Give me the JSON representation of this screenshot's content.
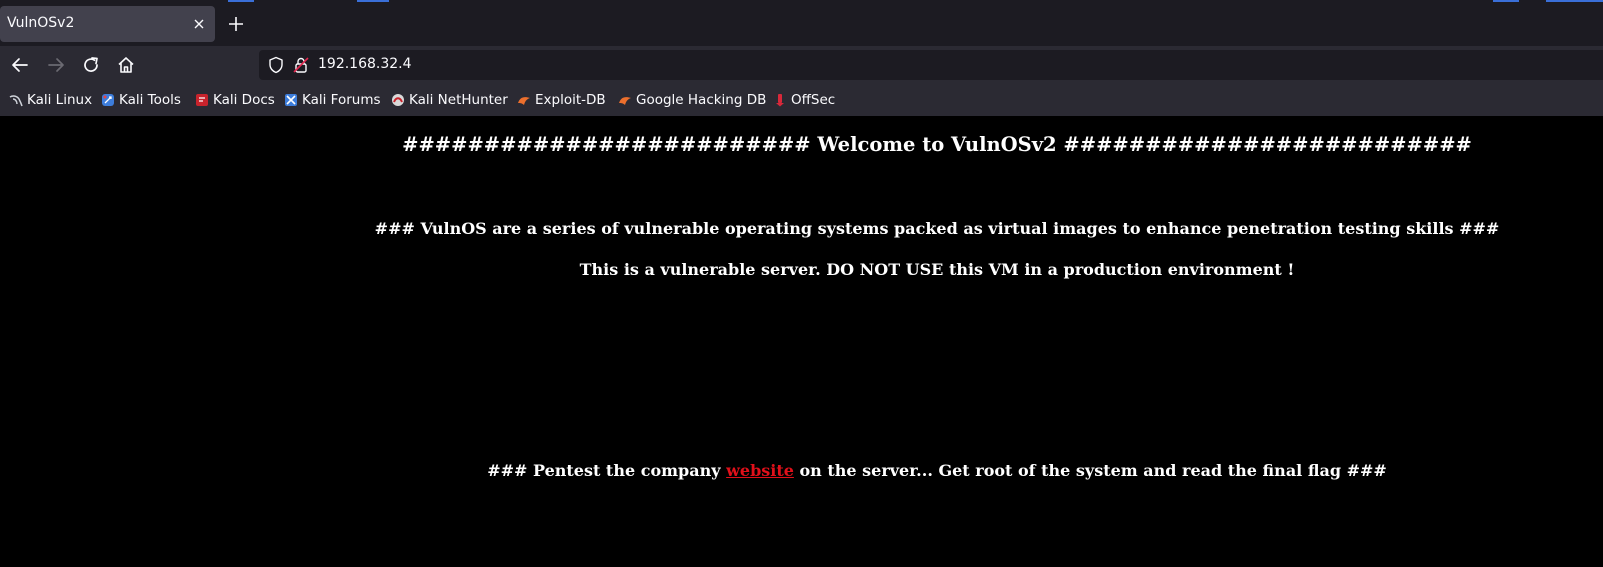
{
  "browser": {
    "tab_title": "VulnOSv2",
    "url": "192.168.32.4",
    "bookmarks": [
      {
        "label": "Kali Linux",
        "icon": "kali-dragon-icon"
      },
      {
        "label": "Kali Tools",
        "icon": "kali-tools-icon"
      },
      {
        "label": "Kali Docs",
        "icon": "kali-docs-icon"
      },
      {
        "label": "Kali Forums",
        "icon": "kali-forums-icon"
      },
      {
        "label": "Kali NetHunter",
        "icon": "kali-nethunter-icon"
      },
      {
        "label": "Exploit-DB",
        "icon": "exploit-db-icon"
      },
      {
        "label": "Google Hacking DB",
        "icon": "ghdb-icon"
      },
      {
        "label": "OffSec",
        "icon": "offsec-icon"
      }
    ]
  },
  "page": {
    "heading": "######################### Welcome to VulnOSv2 #########################",
    "intro": "### VulnOS are a series of vulnerable operating systems packed as virtual images to enhance penetration testing skills ###",
    "warning": "This is a vulnerable server. DO NOT USE this VM in a production environment !",
    "task_prefix": "### Pentest the company ",
    "task_link": "website",
    "task_suffix": " on the server... Get root of the system and read the final flag ###"
  },
  "colors": {
    "page_background": "#000000",
    "link": "#e0101a",
    "chrome_dark": "#1c1b22",
    "chrome": "#2b2a33"
  }
}
